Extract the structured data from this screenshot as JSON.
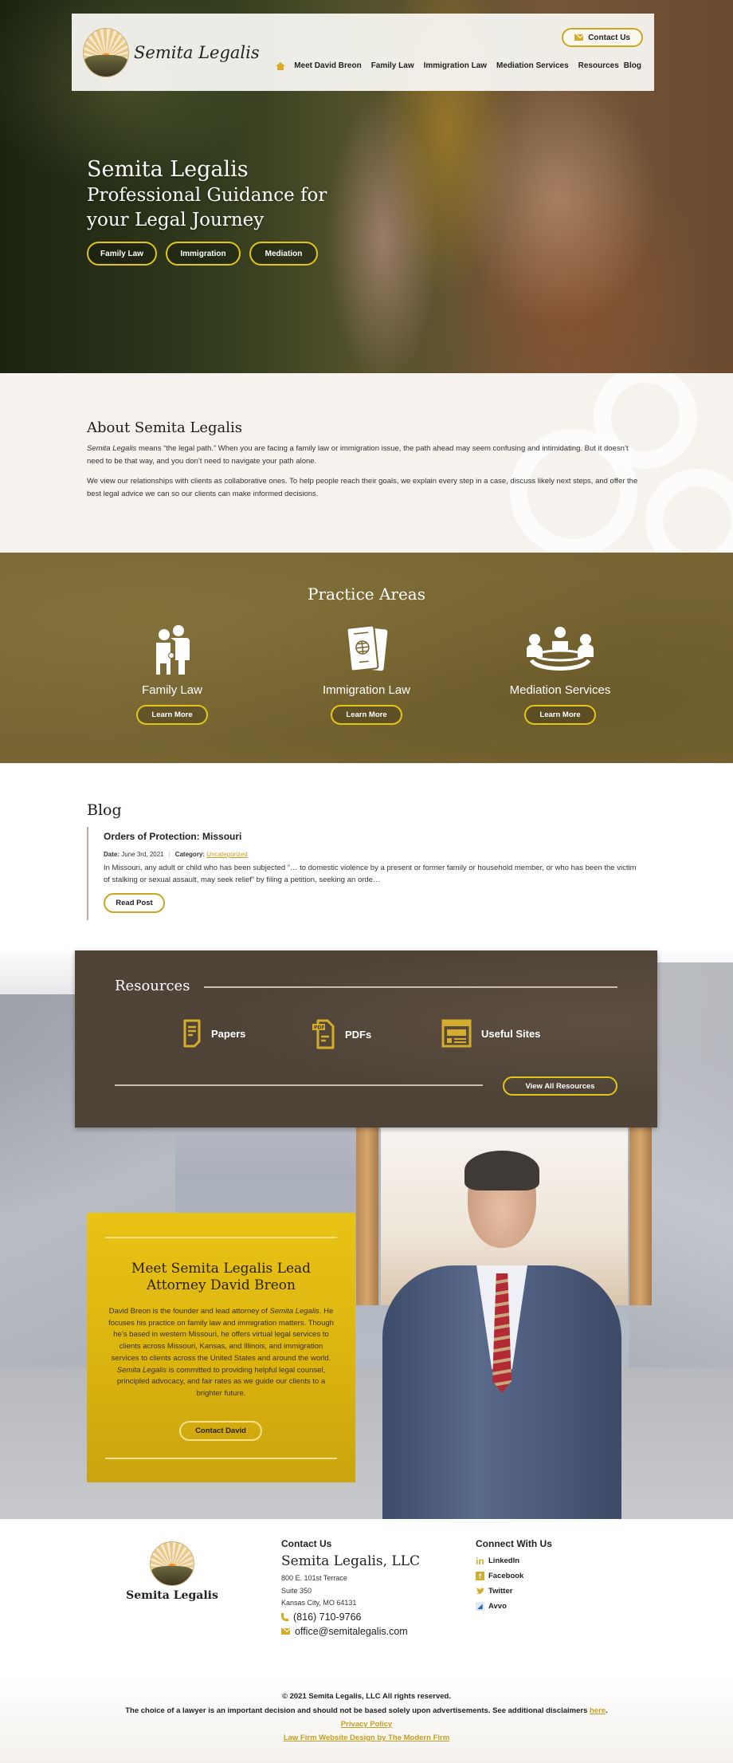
{
  "brand": {
    "name": "Semita Legalis",
    "accent": "#d4ad2c",
    "button_border": "#e1c51a"
  },
  "header": {
    "contact_label": "Contact Us",
    "nav": [
      "Meet David Breon",
      "Family Law",
      "Immigration Law",
      "Mediation Services",
      "Resources",
      "Blog"
    ]
  },
  "hero": {
    "title": "Semita Legalis",
    "subtitle_line1": "Professional Guidance for",
    "subtitle_line2": "your Legal Journey",
    "buttons": [
      "Family Law",
      "Immigration",
      "Mediation"
    ]
  },
  "about": {
    "heading": "About Semita Legalis",
    "p1_em": "Semita Legalis",
    "p1_rest": " means “the legal path.” When you are facing a family law or immigration issue, the path ahead may seem confusing and intimidating. But it doesn’t need to be that way, and you don’t need to navigate your path alone.",
    "p2": "We view our relationships with clients as collaborative ones. To help people reach their goals, we explain every step in a case, discuss likely next steps, and offer the best legal advice we can so our clients can make informed decisions."
  },
  "practice": {
    "heading": "Practice Areas",
    "areas": [
      {
        "icon": "family-icon",
        "label": "Family Law",
        "button": "Learn More"
      },
      {
        "icon": "passport-icon",
        "label": "Immigration Law",
        "button": "Learn More"
      },
      {
        "icon": "meeting-table-icon",
        "label": "Mediation Services",
        "button": "Learn More"
      }
    ]
  },
  "blog": {
    "heading": "Blog",
    "post": {
      "title": "Orders of Protection: Missouri",
      "date_label": "Date:",
      "date": "June 3rd, 2021",
      "category_label": "Category:",
      "category": "Uncategorized",
      "excerpt": "In Missouri, any adult or child who has been subjected “… to domestic violence by a present or former family or household member, or who has been the victim of stalking or sexual assault, may seek relief” by filing a petition, seeking an orde…",
      "button": "Read Post"
    }
  },
  "resources": {
    "heading": "Resources",
    "items": [
      {
        "icon": "document-icon",
        "label": "Papers"
      },
      {
        "icon": "pdf-icon",
        "label": "PDFs"
      },
      {
        "icon": "website-icon",
        "label": "Useful Sites"
      }
    ],
    "button": "View All Resources"
  },
  "meet": {
    "heading": "Meet Semita Legalis Lead Attorney David Breon",
    "p_a": "David Breon is the founder and lead attorney of ",
    "p_em1": "Semita Legalis",
    "p_b": ". He focuses his practice on family law and immigration matters. Though he’s based in western Missouri, he offers virtual legal services to clients across Missouri, Kansas, and Illinois, and immigration services to clients across the United States and around the world. ",
    "p_em2": "Semita Legalis",
    "p_c": " is committed to providing helpful legal counsel, principled advocacy, and fair rates as we guide our clients to a brighter future.",
    "button": "Contact David"
  },
  "footer": {
    "logo_name": "Semita Legalis",
    "contact_heading": "Contact Us",
    "firm": "Semita Legalis, LLC",
    "address": [
      "800 E. 101st Terrace",
      "Suite 350",
      "Kansas City, MO 64131"
    ],
    "phone": "(816) 710-9766",
    "email": "office@semitalegalis.com",
    "connect_heading": "Connect With Us",
    "social": [
      {
        "icon": "linkedin-icon",
        "label": "LinkedIn"
      },
      {
        "icon": "facebook-icon",
        "label": "Facebook"
      },
      {
        "icon": "twitter-icon",
        "label": "Twitter"
      },
      {
        "icon": "avvo-icon",
        "label": "Avvo"
      }
    ],
    "copyright": "© 2021 Semita Legalis, LLC All rights reserved.",
    "disclaimer": "The choice of a lawyer is an important decision and should not be based solely upon advertisements. See additional disclaimers ",
    "disclaimer_link": "here",
    "privacy": "Privacy Policy",
    "credit": "Law Firm Website Design by The Modern Firm"
  }
}
